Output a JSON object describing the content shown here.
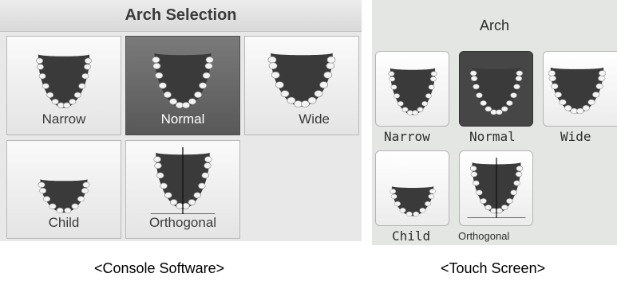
{
  "console": {
    "title": "Arch Selection",
    "buttons": [
      {
        "label": "Narrow",
        "selected": false,
        "icon": "narrow-arch-icon"
      },
      {
        "label": "Normal",
        "selected": true,
        "icon": "normal-arch-icon"
      },
      {
        "label": "Wide",
        "selected": false,
        "icon": "wide-arch-icon"
      },
      {
        "label": "Child",
        "selected": false,
        "icon": "child-arch-icon"
      },
      {
        "label": "Orthogonal",
        "selected": false,
        "icon": "orthogonal-arch-icon"
      }
    ]
  },
  "touch": {
    "title": "Arch",
    "buttons": [
      {
        "label": "Narrow",
        "selected": false
      },
      {
        "label": "Normal",
        "selected": true
      },
      {
        "label": "Wide",
        "selected": false
      },
      {
        "label": "Child",
        "selected": false
      },
      {
        "label": "Orthogonal",
        "selected": false
      }
    ]
  },
  "captions": {
    "console": "<Console Software>",
    "touch": "<Touch Screen>"
  }
}
